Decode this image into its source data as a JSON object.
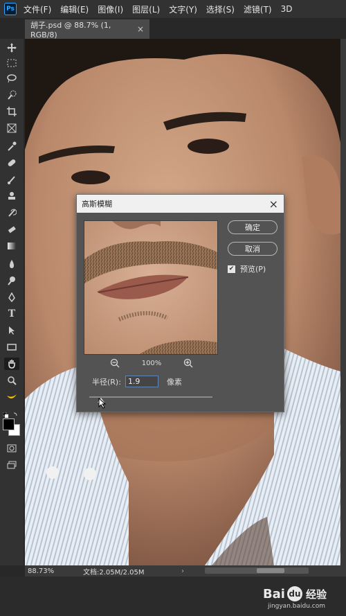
{
  "app": {
    "logo": "Ps"
  },
  "menubar": {
    "items": [
      "文件(F)",
      "编辑(E)",
      "图像(I)",
      "图层(L)",
      "文字(Y)",
      "选择(S)",
      "滤镜(T)",
      "3D"
    ]
  },
  "tab": {
    "title": "胡子.psd @ 88.7% (1, RGB/8)",
    "close": "×"
  },
  "tools": [
    "move-icon",
    "marquee-icon",
    "lasso-icon",
    "quick-select-icon",
    "crop-icon",
    "frame-icon",
    "eyedropper-icon",
    "healing-brush-icon",
    "brush-icon",
    "clone-stamp-icon",
    "history-brush-icon",
    "eraser-icon",
    "gradient-icon",
    "blur-icon",
    "dodge-icon",
    "pen-icon",
    "type-icon",
    "path-select-icon",
    "rectangle-icon",
    "hand-icon",
    "zoom-icon",
    "banana-icon"
  ],
  "dialog": {
    "title": "高斯模糊",
    "close": "×",
    "ok_label": "确定",
    "cancel_label": "取消",
    "preview_label": "预览(P)",
    "preview_checked": true,
    "zoom_out": "−",
    "zoom_level": "100%",
    "zoom_in": "+",
    "radius_label": "半径(R):",
    "radius_value": "1.9",
    "radius_unit": "像素"
  },
  "status": {
    "zoom": "88.73%",
    "doc": "文档:2.05M/2.05M",
    "arrow": "›"
  },
  "watermark": {
    "brand_a": "Bai",
    "brand_paw": "du",
    "brand_b": "经验",
    "url": "jingyan.baidu.com"
  },
  "colors": {
    "accent": "#31a8ff",
    "panel": "#535353",
    "chrome": "#323232"
  }
}
